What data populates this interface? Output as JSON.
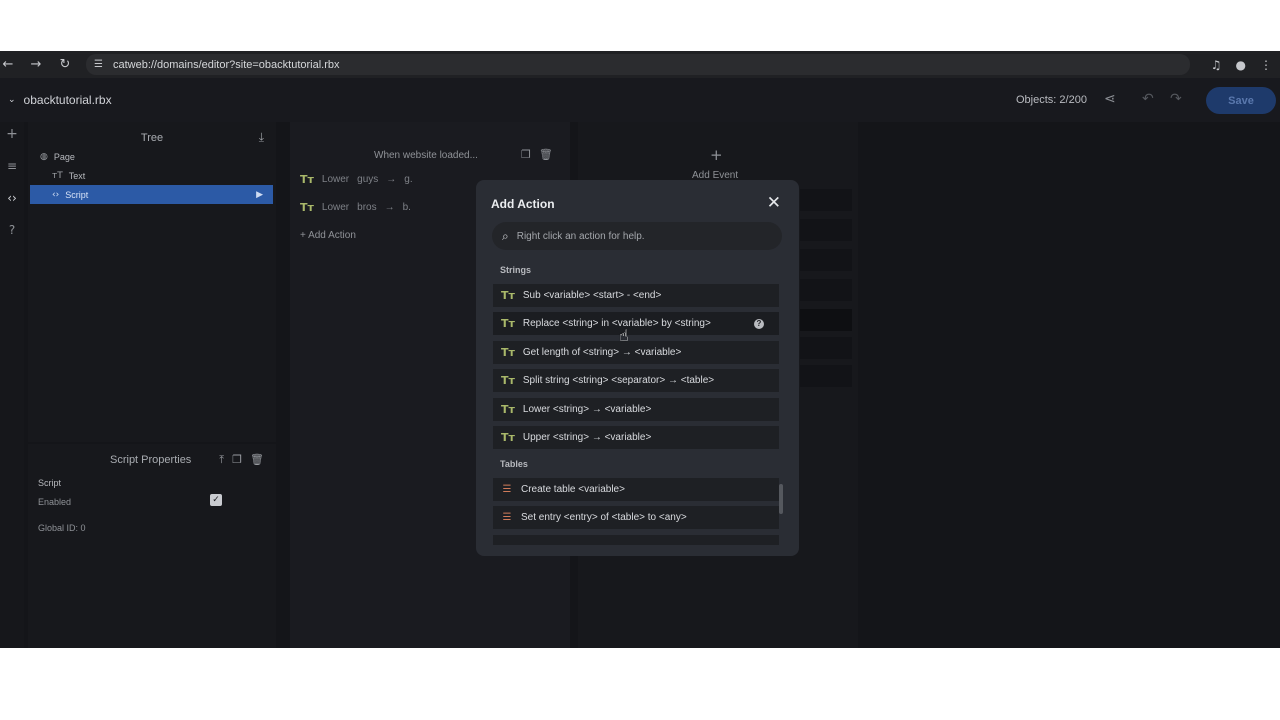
{
  "browser": {
    "url": "catweb://domains/editor?site=obacktutorial.rbx",
    "back_icon": "arrow-left-icon",
    "forward_icon": "arrow-right-icon",
    "reload_icon": "reload-icon"
  },
  "app": {
    "site_name": "obacktutorial.rbx",
    "objects": "Objects: 2/200",
    "save_label": "Save"
  },
  "tree": {
    "title": "Tree",
    "items": [
      {
        "label": "Page",
        "icon": "globe-icon"
      },
      {
        "label": "Text",
        "icon": "text-icon"
      },
      {
        "label": "Script",
        "icon": "code-icon"
      }
    ]
  },
  "properties": {
    "title": "Script Properties",
    "section": "Script",
    "enabled_label": "Enabled",
    "enabled": true,
    "global_id": "Global ID: 0"
  },
  "event": {
    "header": "When website loaded...",
    "rows": [
      {
        "verb": "Lower",
        "arg": "guys",
        "target": "g."
      },
      {
        "verb": "Lower",
        "arg": "bros",
        "target": "b."
      }
    ],
    "add_action": "+ Add Action"
  },
  "add_event": {
    "label": "Add Event"
  },
  "modal": {
    "title": "Add Action",
    "search_placeholder": "Right click an action for help.",
    "sections": [
      {
        "label": "Strings",
        "actions": [
          "Sub <variable> <start> - <end>",
          "Replace <string> in <variable> by <string>",
          "Get length of <string> → <variable>",
          "Split string <string> <separator> → <table>",
          "Lower <string> → <variable>",
          "Upper <string> → <variable>"
        ]
      },
      {
        "label": "Tables",
        "actions": [
          "Create table <variable>",
          "Set entry <entry> of <table> to <any>"
        ]
      }
    ]
  },
  "colors": {
    "accent": "#2c5aa6",
    "string_icon": "#a9b86a",
    "table_icon": "#d07b5a"
  }
}
